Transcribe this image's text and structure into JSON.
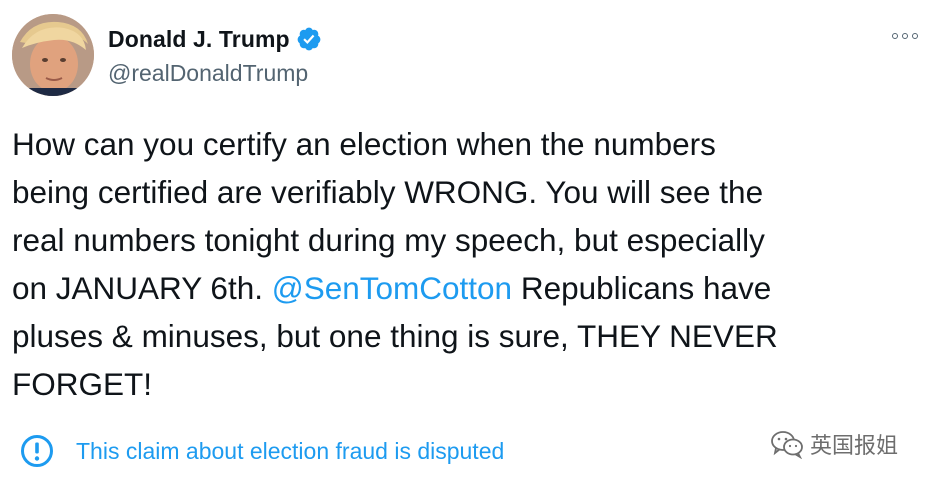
{
  "author": {
    "display_name": "Donald J. Trump",
    "handle": "@realDonaldTrump",
    "verified": true
  },
  "tweet": {
    "lines": [
      {
        "before": "How can you certify an election when the numbers"
      },
      {
        "before": "being certified are verifiably WRONG. You will see the"
      },
      {
        "before": "real numbers tonight during my speech, but especially"
      },
      {
        "before": "on JANUARY 6th. ",
        "mention": "@SenTomCotton",
        "after": " Republicans have"
      },
      {
        "before": "pluses & minuses, but one thing is sure, THEY NEVER"
      },
      {
        "before": "FORGET!"
      }
    ]
  },
  "notice": {
    "text": "This claim about election fraud is disputed",
    "icon": "exclamation-circle-icon"
  },
  "watermark": {
    "text": "英国报姐",
    "icon": "wechat-icon"
  },
  "icons": {
    "verified": "verified-badge-icon",
    "more": "more-options-icon"
  },
  "colors": {
    "accent": "#1d9bf0",
    "text": "#0f1419",
    "secondary": "#536471"
  }
}
